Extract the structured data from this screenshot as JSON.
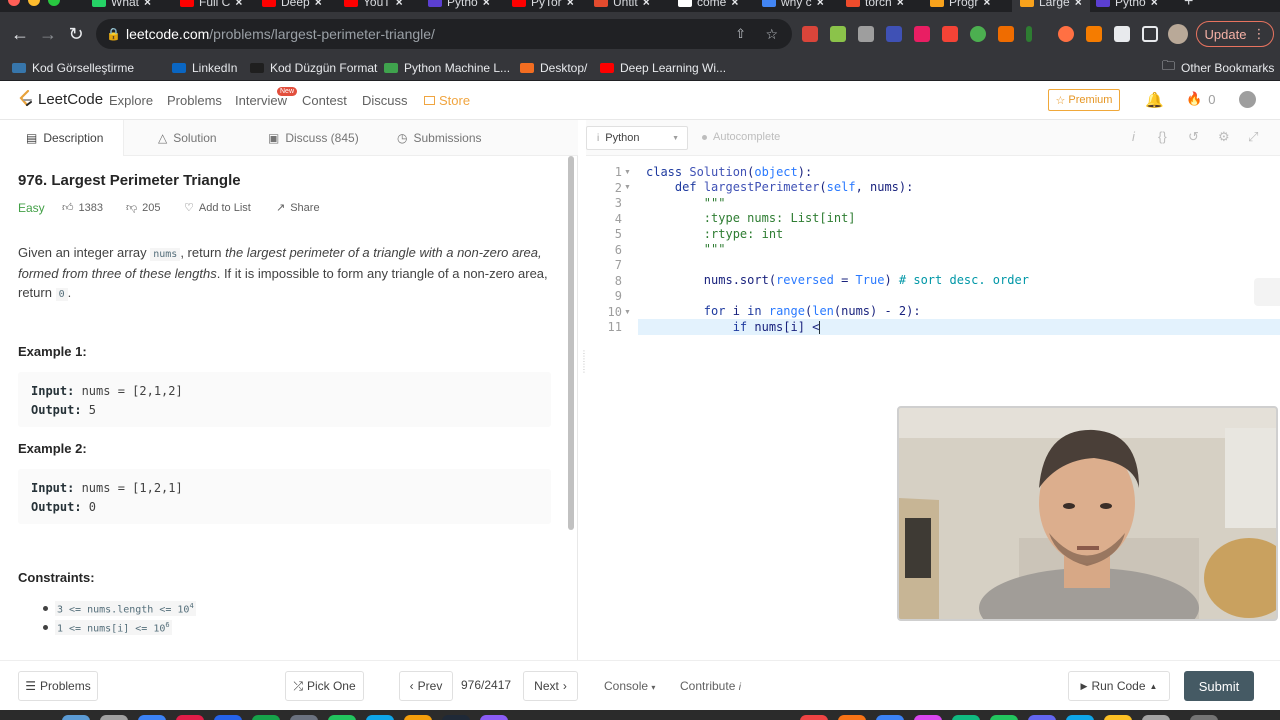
{
  "browser": {
    "tabs": [
      {
        "title": "What",
        "color": "#25d366"
      },
      {
        "title": "Full C",
        "color": "#ff0000"
      },
      {
        "title": "Deep",
        "color": "#ff0000"
      },
      {
        "title": "YouT",
        "color": "#ff0000"
      },
      {
        "title": "Pytho",
        "color": "#5b3fd1"
      },
      {
        "title": "PyTor",
        "color": "#ff0000"
      },
      {
        "title": "Untit",
        "color": "#e34b2e"
      },
      {
        "title": "come",
        "color": "#ffffff"
      },
      {
        "title": "why c",
        "color": "#4285f4"
      },
      {
        "title": "torch",
        "color": "#ee4c2c"
      },
      {
        "title": "Progr",
        "color": "#f8a21c"
      },
      {
        "title": "Large",
        "color": "#f8a21c"
      },
      {
        "title": "Pytho",
        "color": "#5b3fd1"
      }
    ],
    "url_host": "leetcode.com",
    "url_path": "/problems/largest-perimeter-triangle/",
    "update_label": "Update",
    "bookmarks": [
      {
        "label": "Kod Görselleştirme",
        "color": "#3776ab"
      },
      {
        "label": "LinkedIn",
        "color": "#0a66c2"
      },
      {
        "label": "Kod Düzgün Format",
        "color": "#1f1f1f"
      },
      {
        "label": "Python Machine L...",
        "color": "#3fa34d"
      },
      {
        "label": "Desktop/",
        "color": "#f26d21"
      },
      {
        "label": "Deep Learning Wi...",
        "color": "#ff0000"
      }
    ],
    "other_bookmarks": "Other Bookmarks"
  },
  "nav": {
    "logo": "LeetCode",
    "links": [
      "Explore",
      "Problems",
      "Interview",
      "Contest",
      "Discuss"
    ],
    "store": "Store",
    "new_tag": "New",
    "premium": "Premium",
    "points": "0"
  },
  "problem": {
    "tabs": [
      "Description",
      "Solution",
      "Discuss (845)",
      "Submissions"
    ],
    "title": "976. Largest Perimeter Triangle",
    "difficulty": "Easy",
    "likes": "1383",
    "dislikes": "205",
    "add_to_list": "Add to List",
    "share": "Share",
    "desc_1": "Given an integer array ",
    "desc_code": "nums",
    "desc_2": ", return ",
    "desc_em": "the largest perimeter of a triangle with a non-zero area, formed from three of these lengths",
    "desc_3": ". If it is impossible to form any triangle of a non-zero area, return ",
    "desc_zero": "0",
    "desc_4": ".",
    "examples": [
      {
        "heading": "Example 1:",
        "input_label": "Input:",
        "input": " nums = [2,1,2]",
        "output_label": "Output:",
        "output": " 5"
      },
      {
        "heading": "Example 2:",
        "input_label": "Input:",
        "input": " nums = [1,2,1]",
        "output_label": "Output:",
        "output": " 0"
      }
    ],
    "constraints_heading": "Constraints:",
    "constraints": [
      {
        "text": "3 <= nums.length <= 10",
        "sup": "4"
      },
      {
        "text": "1 <= nums[i] <= 10",
        "sup": "6"
      }
    ]
  },
  "editor": {
    "language": "Python",
    "autocomplete": "Autocomplete",
    "line_numbers": [
      "1",
      "2",
      "3",
      "4",
      "5",
      "6",
      "7",
      "8",
      "9",
      "10",
      "11"
    ]
  },
  "bottom": {
    "problems": "Problems",
    "pick_one": "Pick One",
    "prev": "Prev",
    "pager": "976/2417",
    "next": "Next",
    "console": "Console",
    "contribute": "Contribute",
    "run_code": "Run Code",
    "submit": "Submit"
  }
}
